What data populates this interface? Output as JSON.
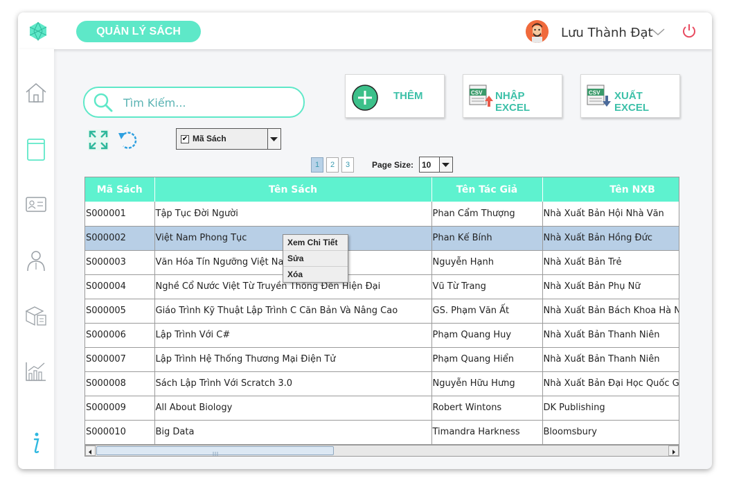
{
  "header": {
    "title": "QUẢN LÝ SÁCH",
    "username": "Lưu Thành Đạt"
  },
  "sidebar": {
    "items": [
      {
        "icon": "home-icon"
      },
      {
        "icon": "book-icon"
      },
      {
        "icon": "id-card-icon"
      },
      {
        "icon": "employee-icon"
      },
      {
        "icon": "package-icon"
      },
      {
        "icon": "chart-icon"
      },
      {
        "icon": "info-icon"
      }
    ]
  },
  "search": {
    "placeholder": "Tìm Kiếm..."
  },
  "actions": {
    "add_label": "THÊM",
    "import_label": "NHẬP EXCEL",
    "export_label": "XUẤT EXCEL",
    "csv": "CSV"
  },
  "filter": {
    "selected": "Mã Sách"
  },
  "pagination": {
    "pages": [
      "1",
      "2",
      "3"
    ],
    "current": "1",
    "page_size_label": "Page Size:",
    "page_size": "10"
  },
  "table": {
    "columns": [
      "Mã Sách",
      "Tên Sách",
      "Tên Tác Giả",
      "Tên NXB"
    ],
    "rows": [
      [
        "S000001",
        "Tập Tục Đời Người",
        "Phan Cẩm Thượng",
        "Nhà Xuất Bản Hội Nhà Văn"
      ],
      [
        "S000002",
        "Việt Nam Phong Tục",
        "Phan Kế Bính",
        "Nhà Xuất Bản Hồng Đức"
      ],
      [
        "S000003",
        " Văn Hóa Tín Ngưỡng Việt Nam",
        "Nguyễn Hạnh",
        "Nhà Xuất Bản Trẻ"
      ],
      [
        "S000004",
        "Nghề Cổ Nước Việt Từ Truyền Thống Đến Hiện Đại",
        "Vũ Từ Trang",
        "Nhà Xuất Bản Phụ Nữ"
      ],
      [
        "S000005",
        "Giáo Trình Kỹ Thuật Lập Trình C Căn Bản Và Nâng Cao",
        "GS. Phạm Văn Ất",
        "Nhà Xuất Bản Bách Khoa Hà Nội"
      ],
      [
        "S000006",
        "Lập Trình Với C#",
        "Phạm Quang Huy",
        "Nhà Xuất Bản Thanh Niên"
      ],
      [
        "S000007",
        "Lập Trình Hệ Thống Thương Mại Điện Tử",
        "Phạm Quang Hiển",
        "Nhà Xuất Bản Thanh Niên"
      ],
      [
        "S000008",
        "Sách Lập Trình Với Scratch 3.0",
        "Nguyễn Hữu Hưng",
        "Nhà Xuất Bản Đại Học Quốc Gia"
      ],
      [
        "S000009",
        "All About Biology",
        "Robert Wintons",
        "DK Publishing"
      ],
      [
        "S000010",
        "Big Data",
        "Timandra Harkness",
        "Bloomsbury"
      ]
    ],
    "selected_row": 1
  },
  "context_menu": {
    "items": [
      "Xem Chi Tiết",
      "Sửa",
      "Xóa"
    ]
  },
  "colors": {
    "accent": "#5ee8c8",
    "header_bg": "#5ef2cf",
    "selected_row": "#b8cfe6"
  }
}
